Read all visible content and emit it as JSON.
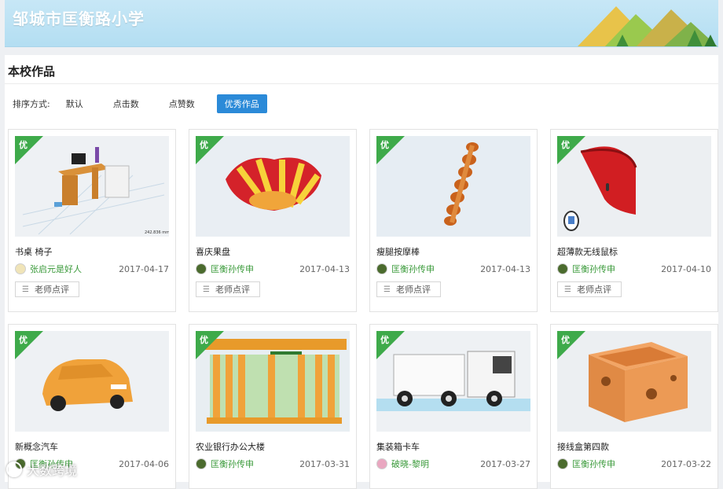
{
  "header": {
    "school_name": "邹城市匡衡路小学"
  },
  "section": {
    "title": "本校作品"
  },
  "sort": {
    "label": "排序方式:",
    "options": [
      "默认",
      "点击数",
      "点赞数",
      "优秀作品"
    ],
    "active": "优秀作品"
  },
  "badge_text": "优",
  "review_button_label": "老师点评",
  "works": [
    {
      "title": "书桌 椅子",
      "author": "张启元是好人",
      "date": "2017-04-17",
      "thumb_icon": "desk-chair-model"
    },
    {
      "title": "喜庆果盘",
      "author": "匡衡孙传申",
      "date": "2017-04-13",
      "thumb_icon": "fruit-plate-model"
    },
    {
      "title": "瘦腿按摩棒",
      "author": "匡衡孙传申",
      "date": "2017-04-13",
      "thumb_icon": "massage-stick-model"
    },
    {
      "title": "超薄款无线鼠标",
      "author": "匡衡孙传申",
      "date": "2017-04-10",
      "thumb_icon": "wireless-mouse-model"
    },
    {
      "title": "新概念汽车",
      "author": "匡衡孙传申",
      "date": "2017-04-06",
      "thumb_icon": "car-model"
    },
    {
      "title": "农业银行办公大楼",
      "author": "匡衡孙传申",
      "date": "2017-03-31",
      "thumb_icon": "bank-building-model"
    },
    {
      "title": "集装箱卡车",
      "author": "破晓-黎明",
      "date": "2017-03-27",
      "thumb_icon": "container-truck-model"
    },
    {
      "title": "接线盒第四款",
      "author": "匡衡孙传申",
      "date": "2017-03-22",
      "thumb_icon": "junction-box-model"
    }
  ],
  "watermark": {
    "text": "大数跨境"
  },
  "colors": {
    "accent": "#2b8ad8",
    "badge": "#3eaa4a",
    "author": "#3a9a3a",
    "banner": "#c7e7f6"
  }
}
